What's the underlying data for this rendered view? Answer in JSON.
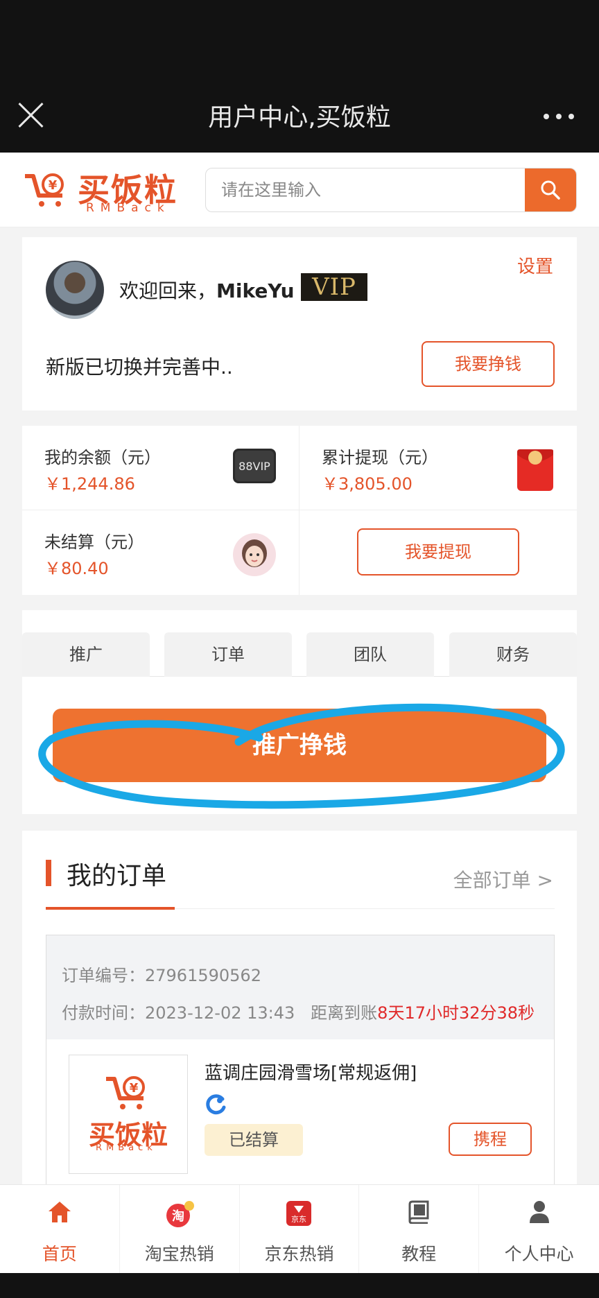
{
  "topbar": {
    "title": "用户中心,买饭粒"
  },
  "header": {
    "logo_text": "买饭粒",
    "logo_sub": "RMBack",
    "search_placeholder": "请在这里输入"
  },
  "profile": {
    "welcome_prefix": "欢迎回来，",
    "username": "MikeYu",
    "vip_label": "VIP",
    "settings_label": "设置",
    "notice": "新版已切换并完善中..",
    "earn_button": "我要挣钱"
  },
  "balance": {
    "my_balance_label": "我的余额（元）",
    "my_balance_value": "￥1,244.86",
    "my_balance_icon_text": "88VIP",
    "total_withdraw_label": "累计提现（元）",
    "total_withdraw_value": "￥3,805.00",
    "unsettled_label": "未结算（元）",
    "unsettled_value": "￥80.40",
    "withdraw_button": "我要提现"
  },
  "tabs": [
    {
      "label": "推广"
    },
    {
      "label": "订单"
    },
    {
      "label": "团队"
    },
    {
      "label": "财务"
    }
  ],
  "promo_button": "推广挣钱",
  "orders": {
    "title": "我的订单",
    "all_link": "全部订单 >",
    "order_no_label": "订单编号：",
    "order_no": "27961590562",
    "pay_time_label": "付款时间：",
    "pay_time": "2023-12-02 13:43",
    "arrival_label": "距离到账",
    "countdown": "8天17小时32分38秒",
    "product_name": "蓝调庄园滑雪场[常规返佣]",
    "status": "已结算",
    "platform_button": "携程",
    "thumb_brand": "买饭粒",
    "thumb_sub": "RMBack"
  },
  "bottom_nav": [
    {
      "label": "首页",
      "icon": "home-icon",
      "active": true
    },
    {
      "label": "淘宝热销",
      "icon": "taobao-icon",
      "icon_text": "淘"
    },
    {
      "label": "京东热销",
      "icon": "jd-icon",
      "icon_text": "京东"
    },
    {
      "label": "教程",
      "icon": "book-icon"
    },
    {
      "label": "个人中心",
      "icon": "user-icon"
    }
  ],
  "colors": {
    "accent": "#e4542a",
    "promo": "#ee7230",
    "countdown": "#e02a2a",
    "annotation": "#1aa8e6"
  }
}
